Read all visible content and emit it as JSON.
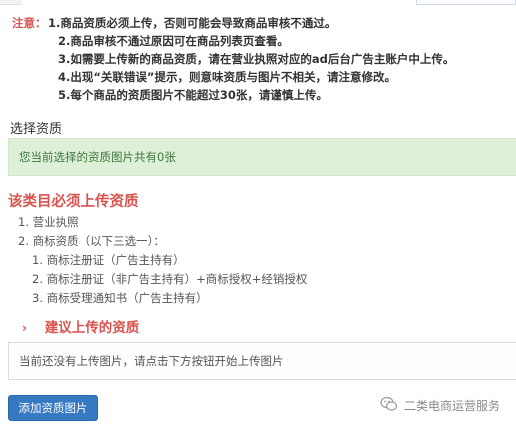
{
  "notes": {
    "label": "注意：",
    "items": [
      "1.商品资质必须上传，否则可能会导致商品审核不通过。",
      "2.商品审核不通过原因可在商品列表页查看。",
      "3.如需要上传新的商品资质，请在营业执照对应的ad后台广告主账户中上传。",
      "4.出现“关联错误”提示，则意味资质与图片不相关，请注意修改。",
      "5.每个商品的资质图片不能超过30张，请谨慎上传。"
    ]
  },
  "select_section": {
    "title": "选择资质",
    "count_message": "您当前选择的资质图片共有0张"
  },
  "required": {
    "title": "该类目必须上传资质",
    "items": [
      "1. 营业执照",
      "2. 商标资质（以下三选一）："
    ],
    "sub_items": [
      "1. 商标注册证（广告主持有）",
      "2. 商标注册证（非广告主持有）+商标授权+经销授权",
      "3. 商标受理通知书（广告主持有）"
    ]
  },
  "suggested": {
    "chevron": "›",
    "title": "建议上传的资质"
  },
  "upload": {
    "empty_message": "当前还没有上传图片，请点击下方按钮开始上传图片",
    "add_button_label": "添加资质图片"
  },
  "watermark": {
    "icon": "wechat-icon",
    "text": "二类电商运营服务"
  },
  "colors": {
    "warning_red": "#d9534f",
    "success_bg": "#dff0d8",
    "success_text": "#3c763d",
    "primary_button": "#3479c2"
  }
}
